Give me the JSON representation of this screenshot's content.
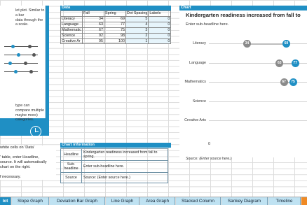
{
  "left_card": {
    "lines_top": [
      "lot plot. Similar to a bar",
      "data through the",
      "a scale."
    ],
    "lines_bottom": [
      "type can compare multiple",
      "maybe more) categories."
    ],
    "clock_icon": "clock-icon"
  },
  "left_notes": [
    "white cells on 'Data'",
    "",
    "' table, enter Headline,",
    "source. It will automatically",
    "chart on the right.",
    "",
    "f necessary."
  ],
  "data_section": {
    "header": "Data",
    "columns": [
      "",
      "Fall",
      "Spring",
      "Dot Spacing",
      "Labels"
    ],
    "rows": [
      [
        "Literacy",
        "34",
        "69",
        "5",
        "0"
      ],
      [
        "Language",
        "63",
        "77",
        "4",
        "0"
      ],
      [
        "Mathematic",
        "67",
        "75",
        "3",
        "0"
      ],
      [
        "Science",
        "92",
        "98",
        "2",
        "0"
      ],
      [
        "Creative Ar",
        "95",
        "100",
        "1",
        "0"
      ]
    ]
  },
  "chart_info": {
    "header": "Chart information",
    "headline_label": "Headline",
    "headline_value": "Kindergarten readiness increased from fall to spring.",
    "subheadline_label": "Sub-headline",
    "subheadline_value": "Enter sub-headline here.",
    "source_label": "Source",
    "source_value": "Source: (Enter source here.)"
  },
  "chart_section": {
    "header": "Chart",
    "title": "Kindergarten readiness increased from fall to",
    "subtitle": "Enter sub-headline here.",
    "axis_zero": "0",
    "source": "Source: (Enter source here.)",
    "colors": {
      "fall": "#8a8a8a",
      "spring": "#1f8fc4"
    }
  },
  "chart_data": {
    "type": "scatter",
    "title": "Kindergarten readiness increased from fall to",
    "categories": [
      "Literacy",
      "Language",
      "Mathematics",
      "Science",
      "Creative Arts"
    ],
    "series": [
      {
        "values": [
          34,
          63,
          67,
          null,
          null
        ]
      },
      {
        "values": [
          69,
          77,
          75,
          null,
          null
        ]
      }
    ],
    "visible_labels": {
      "fall": [
        "34",
        "63",
        "67"
      ],
      "spring": [
        "69",
        "77",
        "75"
      ]
    }
  },
  "tabs": [
    "lot",
    "Slope Graph",
    "Deviation Bar Graph",
    "Line Graph",
    "Area Graph",
    "Stacked Column",
    "Sankey Diagram",
    "Timeline"
  ]
}
